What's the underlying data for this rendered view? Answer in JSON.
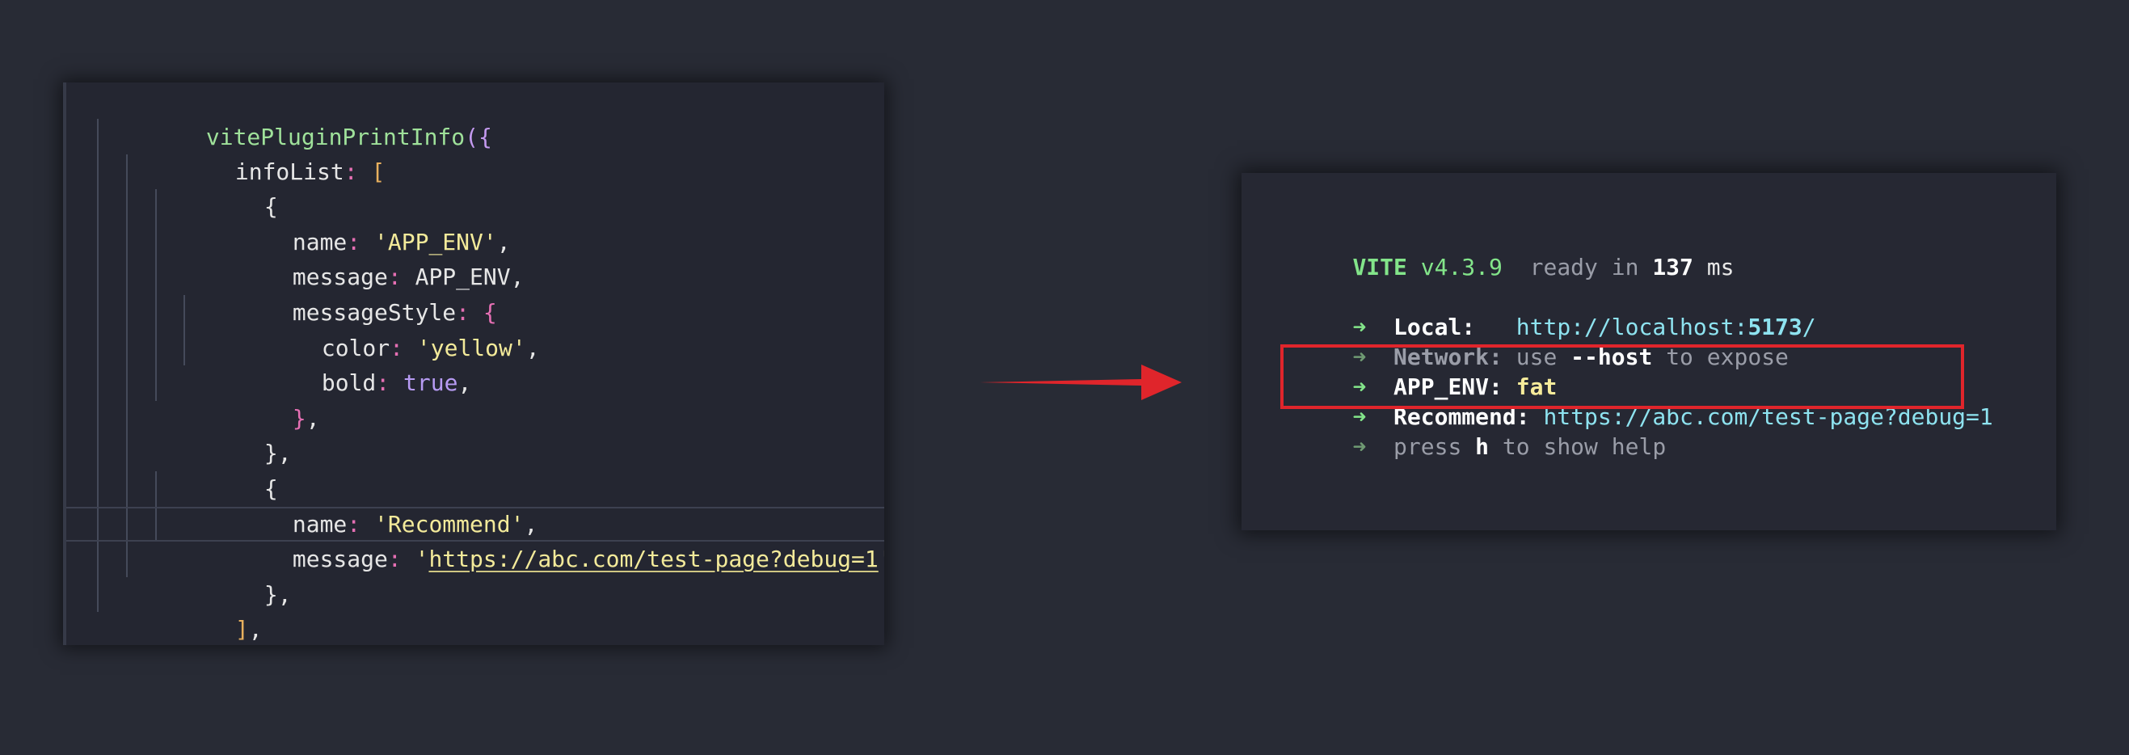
{
  "code": {
    "line1": {
      "fn": "vitePluginPrintInfo",
      "paren": "(",
      "brace": "{"
    },
    "line2": {
      "prop": "infoList",
      "colon": ": ",
      "bracket": "["
    },
    "line3": {
      "brace": "{"
    },
    "line4": {
      "prop": "name",
      "colon": ": ",
      "str": "'APP_ENV'",
      "comma": ","
    },
    "line5": {
      "prop": "message",
      "colon": ": ",
      "value": "APP_ENV",
      "comma": ","
    },
    "line6": {
      "prop": "messageStyle",
      "colon": ": ",
      "brace": "{"
    },
    "line7": {
      "prop": "color",
      "colon": ": ",
      "str": "'yellow'",
      "comma": ","
    },
    "line8": {
      "prop": "bold",
      "colon": ": ",
      "bool": "true",
      "comma": ","
    },
    "line9": {
      "brace": "}",
      "comma": ","
    },
    "line10": {
      "brace": "}",
      "comma": ","
    },
    "line11": {
      "brace": "{"
    },
    "line12": {
      "prop": "name",
      "colon": ": ",
      "str": "'Recommend'",
      "comma": ","
    },
    "line13": {
      "prop": "message",
      "colon": ": ",
      "quote_open": "'",
      "url": "https://abc.com/test-page?debug=1",
      "quote_close": "'",
      "comma": ","
    },
    "line14": {
      "brace": "}",
      "comma": ","
    },
    "line15": {
      "bracket": "]",
      "comma": ","
    },
    "line16": {
      "brace": "}",
      "paren": ")",
      "comma": ","
    }
  },
  "terminal": {
    "header": {
      "brand": "VITE",
      "version": "v4.3.9",
      "ready": "ready in",
      "ms_value": "137",
      "ms_unit": "ms"
    },
    "arrow_glyph": "➜",
    "local": {
      "label": "Local:",
      "url_prefix": "http://localhost:",
      "port": "5173",
      "url_suffix": "/"
    },
    "network": {
      "label": "Network:",
      "use": "use",
      "flag": "--host",
      "rest": "to expose"
    },
    "app_env": {
      "label": "APP_ENV:",
      "value": "fat"
    },
    "recommend": {
      "label": "Recommend:",
      "value": "https://abc.com/test-page?debug=1"
    },
    "help": {
      "press": "press",
      "key": "h",
      "rest": "to show help"
    }
  },
  "colors": {
    "background": "#282b35",
    "highlight_border": "#e0252b",
    "arrow": "#e0252b",
    "vite_green": "#83e58a"
  },
  "icons": {
    "arrow": "right-arrow-icon"
  }
}
